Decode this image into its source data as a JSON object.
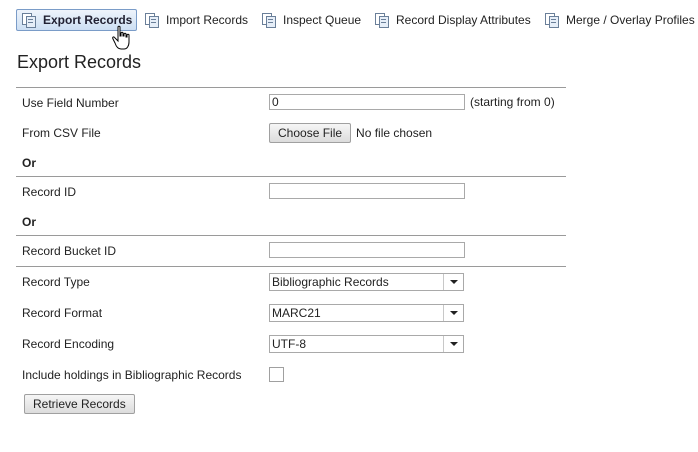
{
  "toolbar": {
    "items": [
      {
        "label": "Export Records",
        "icon": "records-icon",
        "active": true
      },
      {
        "label": "Import Records",
        "icon": "records-icon"
      },
      {
        "label": "Inspect Queue",
        "icon": "records-icon"
      },
      {
        "label": "Record Display Attributes",
        "icon": "records-icon"
      },
      {
        "label": "Merge / Overlay Profiles",
        "icon": "records-icon"
      }
    ]
  },
  "page": {
    "title": "Export Records"
  },
  "form": {
    "field_number": {
      "label": "Use Field Number",
      "value": "0",
      "hint": "(starting from 0)"
    },
    "csv_file": {
      "label": "From CSV File",
      "button": "Choose File",
      "status": "No file chosen"
    },
    "or1": "Or",
    "record_id": {
      "label": "Record ID",
      "value": ""
    },
    "or2": "Or",
    "bucket_id": {
      "label": "Record Bucket ID",
      "value": ""
    },
    "record_type": {
      "label": "Record Type",
      "value": "Bibliographic Records"
    },
    "record_format": {
      "label": "Record Format",
      "value": "MARC21"
    },
    "record_encoding": {
      "label": "Record Encoding",
      "value": "UTF-8"
    },
    "holdings": {
      "label": "Include holdings in Bibliographic Records",
      "checked": false
    },
    "submit": "Retrieve Records"
  },
  "colors": {
    "active_tab_border": "#7a9cc8",
    "divider": "#9a9a9a"
  }
}
